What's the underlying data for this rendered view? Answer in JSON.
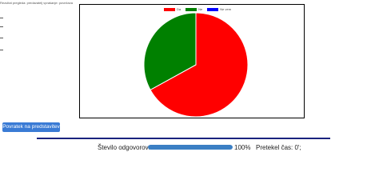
{
  "header": {
    "text": "Rezultat pregleda: predavatelj vprašanje: povežava"
  },
  "chart_data": {
    "type": "pie",
    "labels": [
      "Da",
      "Ne",
      "Ne vem"
    ],
    "values": [
      67,
      33,
      0
    ],
    "colors": [
      "#ff0000",
      "#008000",
      "#0000ff"
    ],
    "legend": "top"
  },
  "actions": {
    "back_label": "Povratek na predstavitev"
  },
  "status": {
    "answers_label": "Število odgovorov:",
    "progress_percent": 100,
    "progress_text": "100%",
    "time_label": "Pretekel čas: 0';"
  }
}
